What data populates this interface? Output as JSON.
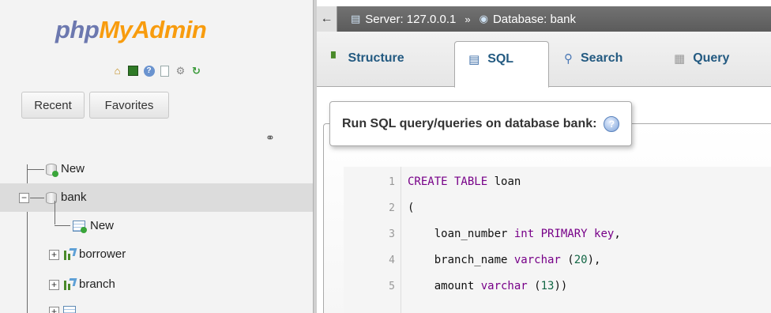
{
  "nav": {
    "logo_part1": "php",
    "logo_part2": "MyAdmin",
    "icons": [
      "home-icon",
      "logout-icon",
      "help-icon",
      "docs-icon",
      "settings-icon",
      "reload-icon"
    ],
    "recent_label": "Recent",
    "favorites_label": "Favorites",
    "tree": {
      "new_label": "New",
      "db_name": "bank",
      "db_new_label": "New",
      "tables": [
        "borrower",
        "branch"
      ]
    }
  },
  "breadcrumb": {
    "server_label": "Server: 127.0.0.1",
    "separator": "»",
    "database_label": "Database: bank"
  },
  "tabs": [
    {
      "label": "Structure",
      "icon": "structure-icon"
    },
    {
      "label": "SQL",
      "icon": "sql-icon",
      "active": true
    },
    {
      "label": "Search",
      "icon": "search-icon"
    },
    {
      "label": "Query",
      "icon": "query-icon"
    }
  ],
  "sql_panel": {
    "legend": "Run SQL query/queries on database bank:",
    "help_glyph": "?"
  },
  "editor": {
    "line_numbers": [
      "1",
      "2",
      "3",
      "4",
      "5"
    ],
    "lines": [
      [
        "CREATE TABLE",
        " loan"
      ],
      [
        "("
      ],
      [
        "    loan_number ",
        "int",
        " ",
        "PRIMARY key",
        ","
      ],
      [
        "    branch_name ",
        "varchar",
        " (",
        "20",
        "),"
      ],
      [
        "    amount ",
        "varchar",
        " (",
        "13",
        "))"
      ]
    ]
  }
}
